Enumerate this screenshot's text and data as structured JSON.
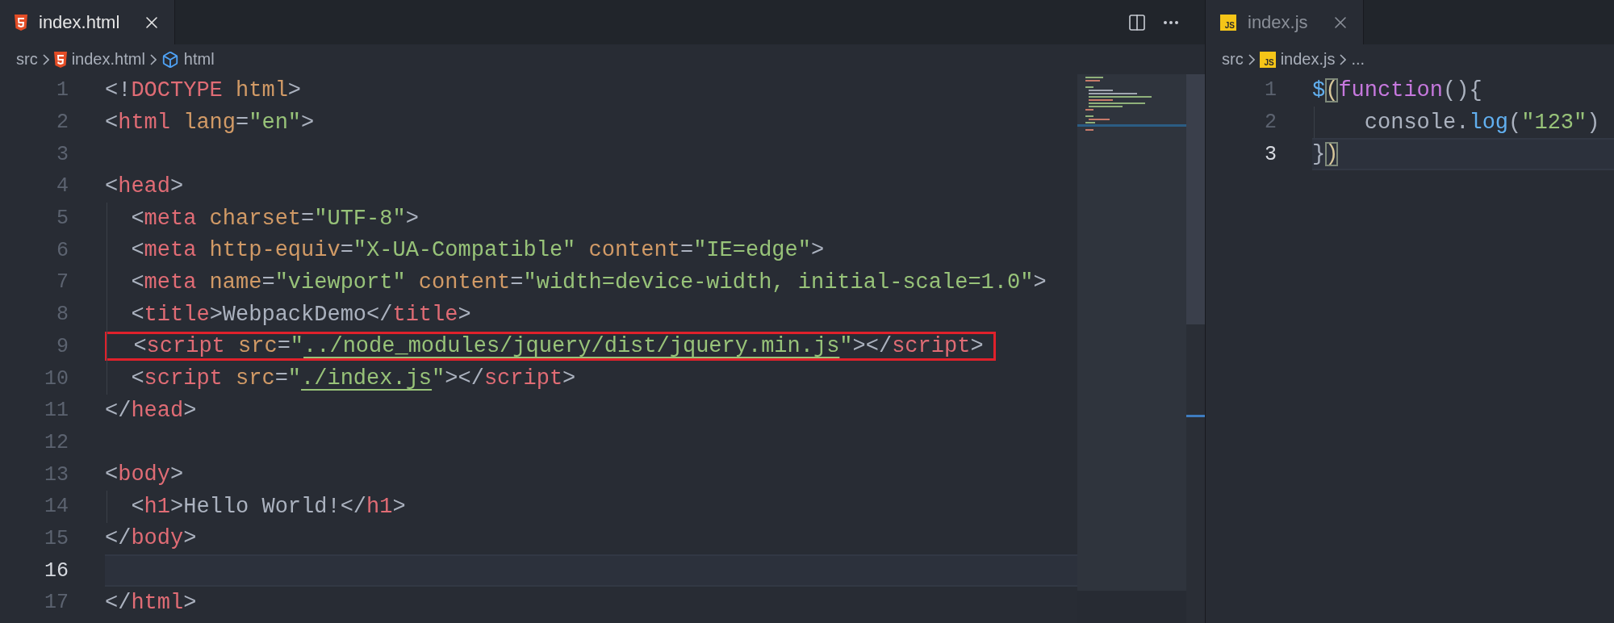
{
  "panes": [
    {
      "focused": true,
      "tabs": [
        {
          "label": "index.html",
          "kind": "html",
          "selected": true
        }
      ],
      "breadcrumb": [
        {
          "label": "src",
          "kind": "folder"
        },
        {
          "label": "index.html",
          "kind": "file"
        },
        {
          "label": "html",
          "kind": "symbol"
        }
      ],
      "lines": [
        {
          "number": "1",
          "current": false,
          "annotated": false,
          "tokens": [
            {
              "kind": "punct",
              "text": "<!"
            },
            {
              "kind": "tag",
              "text": "DOCTYPE"
            },
            {
              "kind": "attr",
              "text": " html"
            },
            {
              "kind": "punct",
              "text": ">"
            }
          ]
        },
        {
          "number": "2",
          "current": false,
          "annotated": false,
          "tokens": [
            {
              "kind": "punct",
              "text": "<"
            },
            {
              "kind": "tag",
              "text": "html"
            },
            {
              "kind": "attr",
              "text": " lang"
            },
            {
              "kind": "punct",
              "text": "="
            },
            {
              "kind": "string",
              "text": "\"en\""
            },
            {
              "kind": "punct",
              "text": ">"
            }
          ]
        },
        {
          "number": "3",
          "current": false,
          "annotated": false
        },
        {
          "number": "4",
          "current": false,
          "annotated": false,
          "tokens": [
            {
              "kind": "punct",
              "text": "<"
            },
            {
              "kind": "tag",
              "text": "head"
            },
            {
              "kind": "punct",
              "text": ">"
            }
          ]
        },
        {
          "number": "5",
          "current": false,
          "annotated": false,
          "tokens": [
            {
              "kind": "punct",
              "text": "  <"
            },
            {
              "kind": "tag",
              "text": "meta"
            },
            {
              "kind": "attr",
              "text": " charset"
            },
            {
              "kind": "punct",
              "text": "="
            },
            {
              "kind": "string",
              "text": "\"UTF-8\""
            },
            {
              "kind": "punct",
              "text": ">"
            }
          ]
        },
        {
          "number": "6",
          "current": false,
          "annotated": false,
          "tokens": [
            {
              "kind": "punct",
              "text": "  <"
            },
            {
              "kind": "tag",
              "text": "meta"
            },
            {
              "kind": "attr",
              "text": " http-equiv"
            },
            {
              "kind": "punct",
              "text": "="
            },
            {
              "kind": "string",
              "text": "\"X-UA-Compatible\""
            },
            {
              "kind": "attr",
              "text": " content"
            },
            {
              "kind": "punct",
              "text": "="
            },
            {
              "kind": "string",
              "text": "\"IE=edge\""
            },
            {
              "kind": "punct",
              "text": ">"
            }
          ]
        },
        {
          "number": "7",
          "current": false,
          "annotated": false,
          "tokens": [
            {
              "kind": "punct",
              "text": "  <"
            },
            {
              "kind": "tag",
              "text": "meta"
            },
            {
              "kind": "attr",
              "text": " name"
            },
            {
              "kind": "punct",
              "text": "="
            },
            {
              "kind": "string",
              "text": "\"viewport\""
            },
            {
              "kind": "attr",
              "text": " content"
            },
            {
              "kind": "punct",
              "text": "="
            },
            {
              "kind": "string",
              "text": "\"width=device-width, initial-scale=1.0\""
            },
            {
              "kind": "punct",
              "text": ">"
            }
          ]
        },
        {
          "number": "8",
          "current": false,
          "annotated": false,
          "tokens": [
            {
              "kind": "punct",
              "text": "  <"
            },
            {
              "kind": "tag",
              "text": "title"
            },
            {
              "kind": "punct",
              "text": ">"
            },
            {
              "kind": "text",
              "text": "WebpackDemo"
            },
            {
              "kind": "punct",
              "text": "</"
            },
            {
              "kind": "tag",
              "text": "title"
            },
            {
              "kind": "punct",
              "text": ">"
            }
          ]
        },
        {
          "number": "9",
          "current": false,
          "annotated": true,
          "tokens": [
            {
              "kind": "punct",
              "text": "  <"
            },
            {
              "kind": "tag",
              "text": "script"
            },
            {
              "kind": "attr",
              "text": " src"
            },
            {
              "kind": "punct",
              "text": "="
            },
            {
              "kind": "string",
              "text": "\""
            },
            {
              "kind": "link",
              "text": "../node_modules/jquery/dist/jquery.min.js"
            },
            {
              "kind": "string",
              "text": "\""
            },
            {
              "kind": "punct",
              "text": "></"
            },
            {
              "kind": "tag",
              "text": "script"
            },
            {
              "kind": "punct",
              "text": ">"
            }
          ]
        },
        {
          "number": "10",
          "current": false,
          "annotated": false,
          "tokens": [
            {
              "kind": "punct",
              "text": "  <"
            },
            {
              "kind": "tag",
              "text": "script"
            },
            {
              "kind": "attr",
              "text": " src"
            },
            {
              "kind": "punct",
              "text": "="
            },
            {
              "kind": "string",
              "text": "\""
            },
            {
              "kind": "link",
              "text": "./index.js"
            },
            {
              "kind": "string",
              "text": "\""
            },
            {
              "kind": "punct",
              "text": "></"
            },
            {
              "kind": "tag",
              "text": "script"
            },
            {
              "kind": "punct",
              "text": ">"
            }
          ]
        },
        {
          "number": "11",
          "current": false,
          "annotated": false,
          "tokens": [
            {
              "kind": "punct",
              "text": "</"
            },
            {
              "kind": "tag",
              "text": "head"
            },
            {
              "kind": "punct",
              "text": ">"
            }
          ]
        },
        {
          "number": "12",
          "current": false,
          "annotated": false
        },
        {
          "number": "13",
          "current": false,
          "annotated": false,
          "tokens": [
            {
              "kind": "punct",
              "text": "<"
            },
            {
              "kind": "tag",
              "text": "body"
            },
            {
              "kind": "punct",
              "text": ">"
            }
          ]
        },
        {
          "number": "14",
          "current": false,
          "annotated": false,
          "tokens": [
            {
              "kind": "punct",
              "text": "  <"
            },
            {
              "kind": "tag",
              "text": "h1"
            },
            {
              "kind": "punct",
              "text": ">"
            },
            {
              "kind": "text",
              "text": "Hello World!"
            },
            {
              "kind": "punct",
              "text": "</"
            },
            {
              "kind": "tag",
              "text": "h1"
            },
            {
              "kind": "punct",
              "text": ">"
            }
          ]
        },
        {
          "number": "15",
          "current": false,
          "annotated": false,
          "tokens": [
            {
              "kind": "punct",
              "text": "</"
            },
            {
              "kind": "tag",
              "text": "body"
            },
            {
              "kind": "punct",
              "text": ">"
            }
          ]
        },
        {
          "number": "16",
          "current": true,
          "annotated": false
        },
        {
          "number": "17",
          "current": false,
          "annotated": false,
          "tokens": [
            {
              "kind": "punct",
              "text": "</"
            },
            {
              "kind": "tag",
              "text": "html"
            },
            {
              "kind": "punct",
              "text": ">"
            }
          ]
        }
      ]
    },
    {
      "focused": false,
      "tabs": [
        {
          "label": "index.js",
          "kind": "js",
          "icon_text": "JS",
          "selected": true
        }
      ],
      "breadcrumb": [
        {
          "label": "src",
          "kind": "folder"
        },
        {
          "label": "index.js",
          "kind": "file",
          "icon_text": "JS"
        },
        {
          "label": "...",
          "kind": "more"
        }
      ],
      "lines": [
        {
          "number": "1",
          "current": false,
          "annotated": false,
          "tokens": [
            {
              "kind": "func",
              "text": "$"
            },
            {
              "kind": "bracket_match",
              "text": "("
            },
            {
              "kind": "keyword",
              "text": "function"
            },
            {
              "kind": "punct",
              "text": "(){"
            }
          ]
        },
        {
          "number": "2",
          "current": false,
          "annotated": false,
          "tokens": [
            {
              "kind": "text",
              "text": "    console"
            },
            {
              "kind": "punct",
              "text": "."
            },
            {
              "kind": "func",
              "text": "log"
            },
            {
              "kind": "punct",
              "text": "("
            },
            {
              "kind": "string",
              "text": "\"123\""
            },
            {
              "kind": "punct",
              "text": ")"
            }
          ]
        },
        {
          "number": "3",
          "current": true,
          "annotated": false,
          "tokens": [
            {
              "kind": "punct",
              "text": "}"
            },
            {
              "kind": "bracket_match",
              "text": ")"
            }
          ]
        }
      ]
    }
  ]
}
